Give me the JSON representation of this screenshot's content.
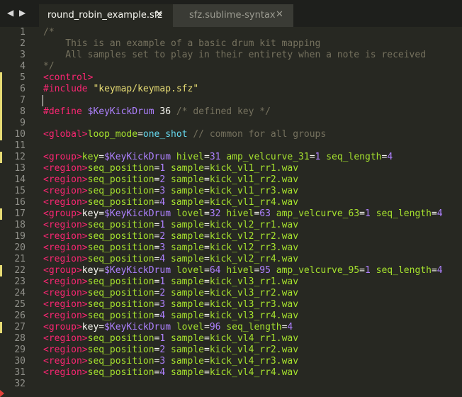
{
  "nav": {
    "arrows": "◀ ▶"
  },
  "tabs": [
    {
      "label": "round_robin_example.sfz",
      "close": "✕",
      "active": true
    },
    {
      "label": "sfz.sublime-syntax",
      "close": "✕",
      "active": false
    }
  ],
  "colors": {
    "background": "#272822",
    "comment": "#75715e",
    "header": "#f92672",
    "opcode": "#a6e22e",
    "string": "#e6db74",
    "variable": "#ae81ff",
    "number": "#ae81ff",
    "constant": "#66d9ef",
    "text": "#f8f8f2"
  },
  "icons": {
    "modified_line_marker": "yellow-bar",
    "scroll_indicator": "red-arrow-icon"
  },
  "editor": {
    "modified_lines": [
      5,
      6,
      7,
      8,
      9,
      10,
      12,
      17,
      22,
      27
    ],
    "cursor_line": 7,
    "lines": [
      {
        "n": "1",
        "tokens": [
          {
            "t": "/*",
            "c": "comment"
          }
        ]
      },
      {
        "n": "2",
        "tokens": [
          {
            "t": "    This is an example of a basic drum kit mapping",
            "c": "comment"
          }
        ]
      },
      {
        "n": "3",
        "tokens": [
          {
            "t": "    All samples set to play in their entirety when a note is received",
            "c": "comment"
          }
        ]
      },
      {
        "n": "4",
        "tokens": [
          {
            "t": "*/",
            "c": "comment"
          }
        ]
      },
      {
        "n": "5",
        "tokens": [
          {
            "t": "<control>",
            "c": "header"
          }
        ]
      },
      {
        "n": "6",
        "tokens": [
          {
            "t": "#include ",
            "c": "header"
          },
          {
            "t": "\"keymap/keymap.sfz\"",
            "c": "string"
          }
        ]
      },
      {
        "n": "7",
        "tokens": []
      },
      {
        "n": "8",
        "tokens": [
          {
            "t": "#define ",
            "c": "header"
          },
          {
            "t": "$KeyKickDrum",
            "c": "variable"
          },
          {
            "t": " 36 ",
            "c": "text"
          },
          {
            "t": "/* defined key */",
            "c": "comment"
          }
        ]
      },
      {
        "n": "9",
        "tokens": []
      },
      {
        "n": "10",
        "tokens": [
          {
            "t": "<global>",
            "c": "header"
          },
          {
            "t": "loop_mode",
            "c": "opcode"
          },
          {
            "t": "=",
            "c": "text"
          },
          {
            "t": "one_shot",
            "c": "constant"
          },
          {
            "t": " // common for all groups",
            "c": "comment"
          }
        ]
      },
      {
        "n": "11",
        "tokens": []
      },
      {
        "n": "12",
        "tokens": [
          {
            "t": "<group>",
            "c": "header"
          },
          {
            "t": "key",
            "c": "opcode"
          },
          {
            "t": "=",
            "c": "text"
          },
          {
            "t": "$KeyKickDrum",
            "c": "variable"
          },
          {
            "t": " ",
            "c": "text"
          },
          {
            "t": "hivel",
            "c": "opcode"
          },
          {
            "t": "=",
            "c": "text"
          },
          {
            "t": "31",
            "c": "number"
          },
          {
            "t": " ",
            "c": "text"
          },
          {
            "t": "amp_velcurve_31",
            "c": "opcode"
          },
          {
            "t": "=",
            "c": "text"
          },
          {
            "t": "1",
            "c": "number"
          },
          {
            "t": " ",
            "c": "text"
          },
          {
            "t": "seq_length",
            "c": "opcode"
          },
          {
            "t": "=",
            "c": "text"
          },
          {
            "t": "4",
            "c": "number"
          }
        ]
      },
      {
        "n": "13",
        "tokens": [
          {
            "t": "<region>",
            "c": "header"
          },
          {
            "t": "seq_position",
            "c": "opcode"
          },
          {
            "t": "=",
            "c": "text"
          },
          {
            "t": "1",
            "c": "number"
          },
          {
            "t": " ",
            "c": "text"
          },
          {
            "t": "sample",
            "c": "opcode"
          },
          {
            "t": "=",
            "c": "text"
          },
          {
            "t": "kick_vl1_rr1.wav",
            "c": "opcode"
          }
        ]
      },
      {
        "n": "14",
        "tokens": [
          {
            "t": "<region>",
            "c": "header"
          },
          {
            "t": "seq_position",
            "c": "opcode"
          },
          {
            "t": "=",
            "c": "text"
          },
          {
            "t": "2",
            "c": "number"
          },
          {
            "t": " ",
            "c": "text"
          },
          {
            "t": "sample",
            "c": "opcode"
          },
          {
            "t": "=",
            "c": "text"
          },
          {
            "t": "kick_vl1_rr2.wav",
            "c": "opcode"
          }
        ]
      },
      {
        "n": "15",
        "tokens": [
          {
            "t": "<region>",
            "c": "header"
          },
          {
            "t": "seq_position",
            "c": "opcode"
          },
          {
            "t": "=",
            "c": "text"
          },
          {
            "t": "3",
            "c": "number"
          },
          {
            "t": " ",
            "c": "text"
          },
          {
            "t": "sample",
            "c": "opcode"
          },
          {
            "t": "=",
            "c": "text"
          },
          {
            "t": "kick_vl1_rr3.wav",
            "c": "opcode"
          }
        ]
      },
      {
        "n": "16",
        "tokens": [
          {
            "t": "<region>",
            "c": "header"
          },
          {
            "t": "seq_position",
            "c": "opcode"
          },
          {
            "t": "=",
            "c": "text"
          },
          {
            "t": "4",
            "c": "number"
          },
          {
            "t": " ",
            "c": "text"
          },
          {
            "t": "sample",
            "c": "opcode"
          },
          {
            "t": "=",
            "c": "text"
          },
          {
            "t": "kick_vl1_rr4.wav",
            "c": "opcode"
          }
        ]
      },
      {
        "n": "17",
        "tokens": [
          {
            "t": "<group>",
            "c": "header"
          },
          {
            "t": "key",
            "c": "text"
          },
          {
            "t": "=",
            "c": "text"
          },
          {
            "t": "$KeyKickDrum",
            "c": "variable"
          },
          {
            "t": " ",
            "c": "text"
          },
          {
            "t": "lovel",
            "c": "opcode"
          },
          {
            "t": "=",
            "c": "text"
          },
          {
            "t": "32",
            "c": "number"
          },
          {
            "t": " ",
            "c": "text"
          },
          {
            "t": "hivel",
            "c": "opcode"
          },
          {
            "t": "=",
            "c": "text"
          },
          {
            "t": "63",
            "c": "number"
          },
          {
            "t": " ",
            "c": "text"
          },
          {
            "t": "amp_velcurve_63",
            "c": "opcode"
          },
          {
            "t": "=",
            "c": "text"
          },
          {
            "t": "1",
            "c": "number"
          },
          {
            "t": " ",
            "c": "text"
          },
          {
            "t": "seq_length",
            "c": "opcode"
          },
          {
            "t": "=",
            "c": "text"
          },
          {
            "t": "4",
            "c": "number"
          }
        ]
      },
      {
        "n": "18",
        "tokens": [
          {
            "t": "<region>",
            "c": "header"
          },
          {
            "t": "seq_position",
            "c": "opcode"
          },
          {
            "t": "=",
            "c": "text"
          },
          {
            "t": "1",
            "c": "number"
          },
          {
            "t": " ",
            "c": "text"
          },
          {
            "t": "sample",
            "c": "opcode"
          },
          {
            "t": "=",
            "c": "text"
          },
          {
            "t": "kick_vl2_rr1.wav",
            "c": "opcode"
          }
        ]
      },
      {
        "n": "19",
        "tokens": [
          {
            "t": "<region>",
            "c": "header"
          },
          {
            "t": "seq_position",
            "c": "opcode"
          },
          {
            "t": "=",
            "c": "text"
          },
          {
            "t": "2",
            "c": "number"
          },
          {
            "t": " ",
            "c": "text"
          },
          {
            "t": "sample",
            "c": "opcode"
          },
          {
            "t": "=",
            "c": "text"
          },
          {
            "t": "kick_vl2_rr2.wav",
            "c": "opcode"
          }
        ]
      },
      {
        "n": "20",
        "tokens": [
          {
            "t": "<region>",
            "c": "header"
          },
          {
            "t": "seq_position",
            "c": "opcode"
          },
          {
            "t": "=",
            "c": "text"
          },
          {
            "t": "3",
            "c": "number"
          },
          {
            "t": " ",
            "c": "text"
          },
          {
            "t": "sample",
            "c": "opcode"
          },
          {
            "t": "=",
            "c": "text"
          },
          {
            "t": "kick_vl2_rr3.wav",
            "c": "opcode"
          }
        ]
      },
      {
        "n": "21",
        "tokens": [
          {
            "t": "<region>",
            "c": "header"
          },
          {
            "t": "seq_position",
            "c": "opcode"
          },
          {
            "t": "=",
            "c": "text"
          },
          {
            "t": "4",
            "c": "number"
          },
          {
            "t": " ",
            "c": "text"
          },
          {
            "t": "sample",
            "c": "opcode"
          },
          {
            "t": "=",
            "c": "text"
          },
          {
            "t": "kick_vl2_rr4.wav",
            "c": "opcode"
          }
        ]
      },
      {
        "n": "22",
        "tokens": [
          {
            "t": "<group>",
            "c": "header"
          },
          {
            "t": "key",
            "c": "text"
          },
          {
            "t": "=",
            "c": "text"
          },
          {
            "t": "$KeyKickDrum",
            "c": "variable"
          },
          {
            "t": " ",
            "c": "text"
          },
          {
            "t": "lovel",
            "c": "opcode"
          },
          {
            "t": "=",
            "c": "text"
          },
          {
            "t": "64",
            "c": "number"
          },
          {
            "t": " ",
            "c": "text"
          },
          {
            "t": "hivel",
            "c": "opcode"
          },
          {
            "t": "=",
            "c": "text"
          },
          {
            "t": "95",
            "c": "number"
          },
          {
            "t": " ",
            "c": "text"
          },
          {
            "t": "amp_velcurve_95",
            "c": "opcode"
          },
          {
            "t": "=",
            "c": "text"
          },
          {
            "t": "1",
            "c": "number"
          },
          {
            "t": " ",
            "c": "text"
          },
          {
            "t": "seq_length",
            "c": "opcode"
          },
          {
            "t": "=",
            "c": "text"
          },
          {
            "t": "4",
            "c": "number"
          }
        ]
      },
      {
        "n": "23",
        "tokens": [
          {
            "t": "<region>",
            "c": "header"
          },
          {
            "t": "seq_position",
            "c": "opcode"
          },
          {
            "t": "=",
            "c": "text"
          },
          {
            "t": "1",
            "c": "number"
          },
          {
            "t": " ",
            "c": "text"
          },
          {
            "t": "sample",
            "c": "opcode"
          },
          {
            "t": "=",
            "c": "text"
          },
          {
            "t": "kick_vl3_rr1.wav",
            "c": "opcode"
          }
        ]
      },
      {
        "n": "24",
        "tokens": [
          {
            "t": "<region>",
            "c": "header"
          },
          {
            "t": "seq_position",
            "c": "opcode"
          },
          {
            "t": "=",
            "c": "text"
          },
          {
            "t": "2",
            "c": "number"
          },
          {
            "t": " ",
            "c": "text"
          },
          {
            "t": "sample",
            "c": "opcode"
          },
          {
            "t": "=",
            "c": "text"
          },
          {
            "t": "kick_vl3_rr2.wav",
            "c": "opcode"
          }
        ]
      },
      {
        "n": "25",
        "tokens": [
          {
            "t": "<region>",
            "c": "header"
          },
          {
            "t": "seq_position",
            "c": "opcode"
          },
          {
            "t": "=",
            "c": "text"
          },
          {
            "t": "3",
            "c": "number"
          },
          {
            "t": " ",
            "c": "text"
          },
          {
            "t": "sample",
            "c": "opcode"
          },
          {
            "t": "=",
            "c": "text"
          },
          {
            "t": "kick_vl3_rr3.wav",
            "c": "opcode"
          }
        ]
      },
      {
        "n": "26",
        "tokens": [
          {
            "t": "<region>",
            "c": "header"
          },
          {
            "t": "seq_position",
            "c": "opcode"
          },
          {
            "t": "=",
            "c": "text"
          },
          {
            "t": "4",
            "c": "number"
          },
          {
            "t": " ",
            "c": "text"
          },
          {
            "t": "sample",
            "c": "opcode"
          },
          {
            "t": "=",
            "c": "text"
          },
          {
            "t": "kick_vl3_rr4.wav",
            "c": "opcode"
          }
        ]
      },
      {
        "n": "27",
        "tokens": [
          {
            "t": "<group>",
            "c": "header"
          },
          {
            "t": "key",
            "c": "text"
          },
          {
            "t": "=",
            "c": "text"
          },
          {
            "t": "$KeyKickDrum",
            "c": "variable"
          },
          {
            "t": " ",
            "c": "text"
          },
          {
            "t": "lovel",
            "c": "opcode"
          },
          {
            "t": "=",
            "c": "text"
          },
          {
            "t": "96",
            "c": "number"
          },
          {
            "t": " ",
            "c": "text"
          },
          {
            "t": "seq_length",
            "c": "opcode"
          },
          {
            "t": "=",
            "c": "text"
          },
          {
            "t": "4",
            "c": "number"
          }
        ]
      },
      {
        "n": "28",
        "tokens": [
          {
            "t": "<region>",
            "c": "header"
          },
          {
            "t": "seq_position",
            "c": "opcode"
          },
          {
            "t": "=",
            "c": "text"
          },
          {
            "t": "1",
            "c": "number"
          },
          {
            "t": " ",
            "c": "text"
          },
          {
            "t": "sample",
            "c": "opcode"
          },
          {
            "t": "=",
            "c": "text"
          },
          {
            "t": "kick_vl4_rr1.wav",
            "c": "opcode"
          }
        ]
      },
      {
        "n": "29",
        "tokens": [
          {
            "t": "<region>",
            "c": "header"
          },
          {
            "t": "seq_position",
            "c": "opcode"
          },
          {
            "t": "=",
            "c": "text"
          },
          {
            "t": "2",
            "c": "number"
          },
          {
            "t": " ",
            "c": "text"
          },
          {
            "t": "sample",
            "c": "opcode"
          },
          {
            "t": "=",
            "c": "text"
          },
          {
            "t": "kick_vl4_rr2.wav",
            "c": "opcode"
          }
        ]
      },
      {
        "n": "30",
        "tokens": [
          {
            "t": "<region>",
            "c": "header"
          },
          {
            "t": "seq_position",
            "c": "opcode"
          },
          {
            "t": "=",
            "c": "text"
          },
          {
            "t": "3",
            "c": "number"
          },
          {
            "t": " ",
            "c": "text"
          },
          {
            "t": "sample",
            "c": "opcode"
          },
          {
            "t": "=",
            "c": "text"
          },
          {
            "t": "kick_vl4_rr3.wav",
            "c": "opcode"
          }
        ]
      },
      {
        "n": "31",
        "tokens": [
          {
            "t": "<region>",
            "c": "header"
          },
          {
            "t": "seq_position",
            "c": "opcode"
          },
          {
            "t": "=",
            "c": "text"
          },
          {
            "t": "4",
            "c": "number"
          },
          {
            "t": " ",
            "c": "text"
          },
          {
            "t": "sample",
            "c": "opcode"
          },
          {
            "t": "=",
            "c": "text"
          },
          {
            "t": "kick_vl4_rr4.wav",
            "c": "opcode"
          }
        ]
      },
      {
        "n": "32",
        "tokens": []
      }
    ]
  }
}
